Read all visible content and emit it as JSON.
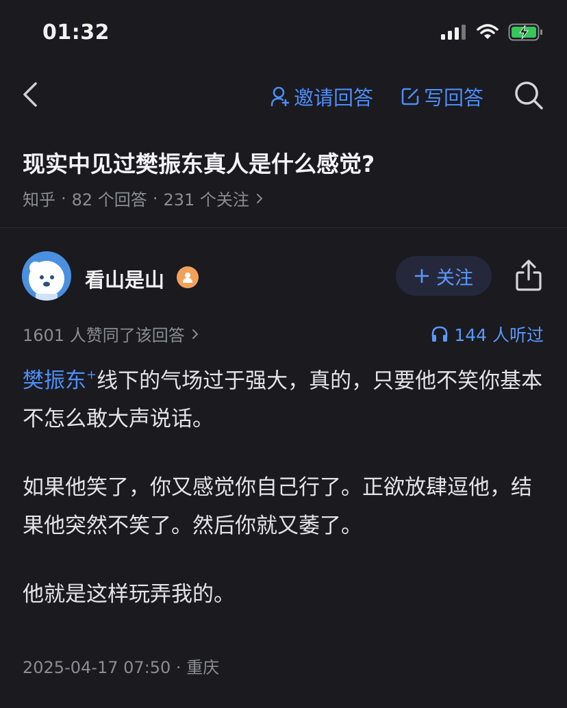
{
  "status_bar": {
    "time": "01:32"
  },
  "nav": {
    "invite_label": "邀请回答",
    "write_label": "写回答"
  },
  "question": {
    "title": "现实中见过樊振东真人是什么感觉?",
    "source": "知乎",
    "answers": "82 个回答",
    "followers": "231 个关注",
    "separator": "·"
  },
  "author": {
    "name": "看山是山",
    "follow_label": "关注"
  },
  "stats": {
    "likes_text": "1601 人赞同了该回答",
    "listens_text": "144 人听过"
  },
  "answer": {
    "link_text": "樊振东",
    "link_mark": "+",
    "p1_rest": "线下的气场过于强大，真的，只要他不笑你基本不怎么敢大声说话。",
    "p2": "如果他笑了，你又感觉你自己行了。正欲放肆逗他，结果他突然不笑了。然后你就又萎了。",
    "p3": "他就是这样玩弄我的。"
  },
  "footer": {
    "datetime": "2025-04-17 07:50",
    "separator": "·",
    "location": "重庆"
  },
  "colors": {
    "accent": "#4d8df7",
    "background": "#1a1a1f",
    "battery": "#35c759"
  }
}
